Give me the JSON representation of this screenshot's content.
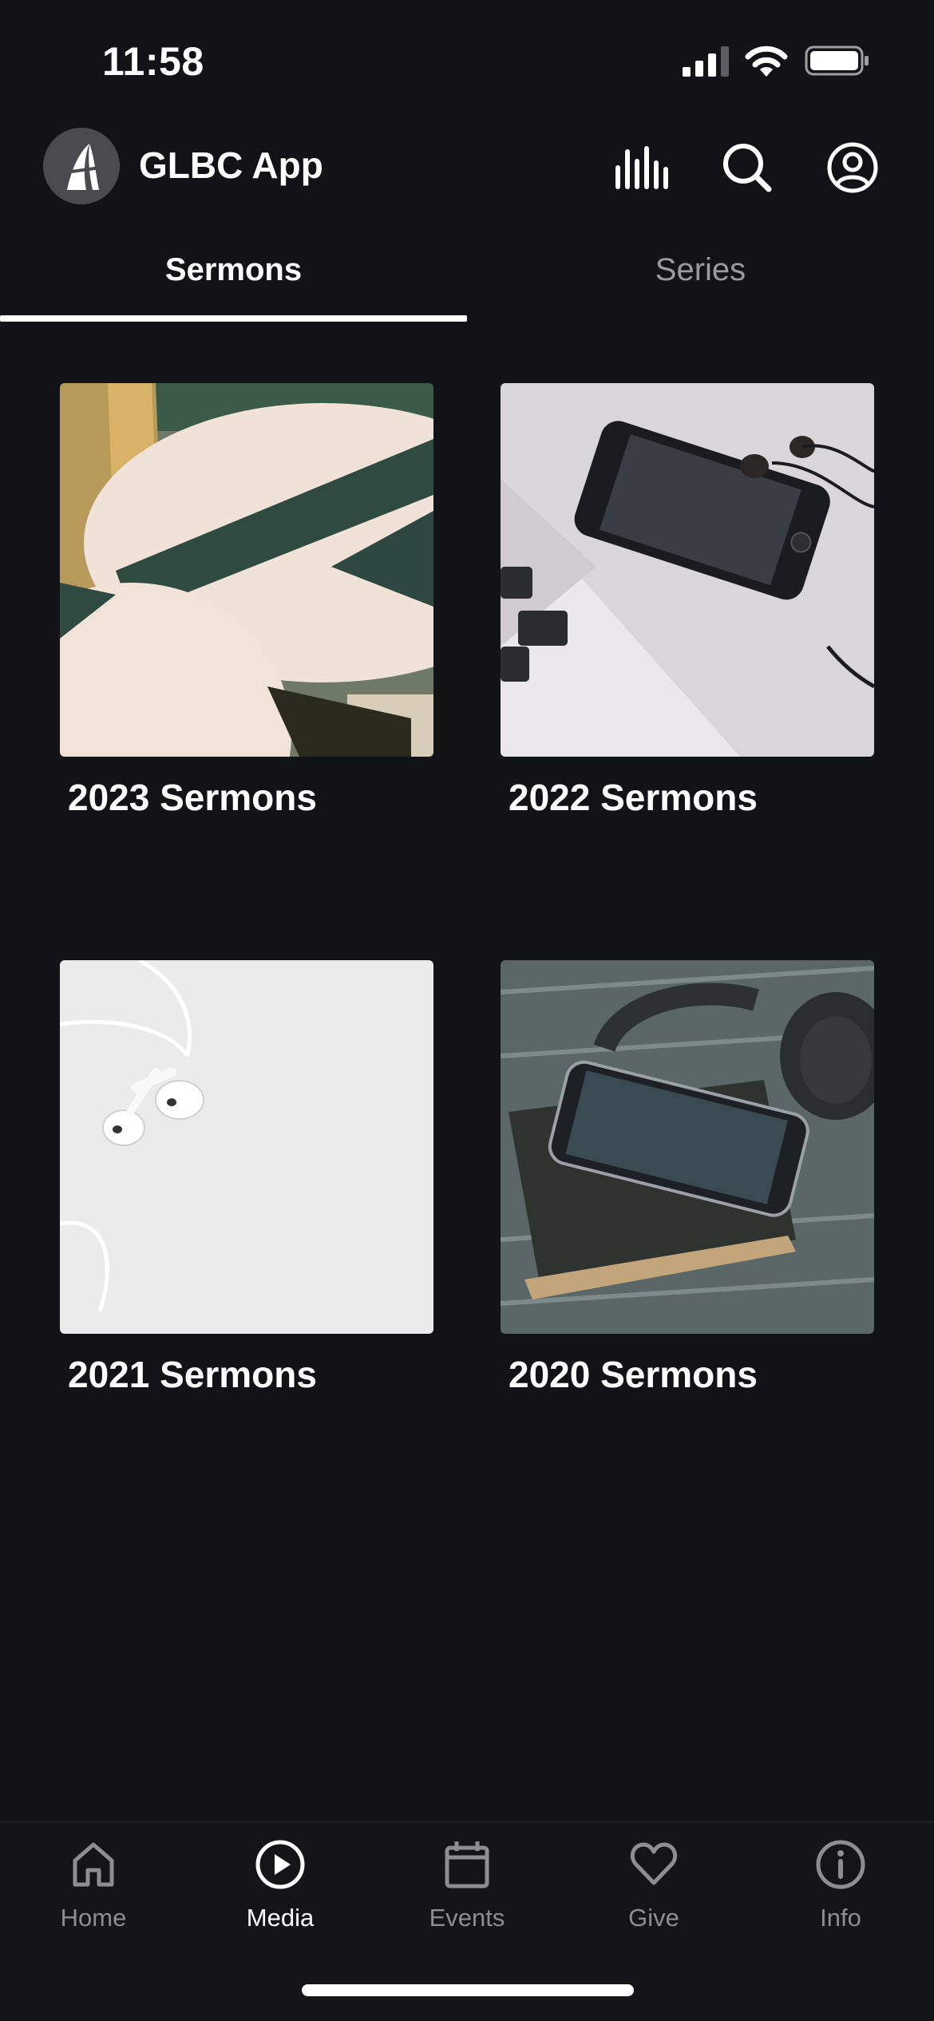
{
  "status_bar": {
    "time": "11:58"
  },
  "header": {
    "title": "GLBC App"
  },
  "tabs": [
    {
      "label": "Sermons",
      "active": true
    },
    {
      "label": "Series",
      "active": false
    }
  ],
  "cards": [
    {
      "title": "2023 Sermons",
      "image": "round-table-photo"
    },
    {
      "title": "2022 Sermons",
      "image": "phone-laptop-earphones-photo"
    },
    {
      "title": "2021 Sermons",
      "image": "white-earbuds-photo"
    },
    {
      "title": "2020 Sermons",
      "image": "headphones-phone-book-photo"
    }
  ],
  "bottom_nav": [
    {
      "label": "Home",
      "icon": "home-icon",
      "active": false
    },
    {
      "label": "Media",
      "icon": "play-circle-icon",
      "active": true
    },
    {
      "label": "Events",
      "icon": "calendar-icon",
      "active": false
    },
    {
      "label": "Give",
      "icon": "heart-icon",
      "active": false
    },
    {
      "label": "Info",
      "icon": "info-icon",
      "active": false
    }
  ],
  "colors": {
    "background": "#121316",
    "text": "#ffffff",
    "muted": "#8d8e93"
  }
}
